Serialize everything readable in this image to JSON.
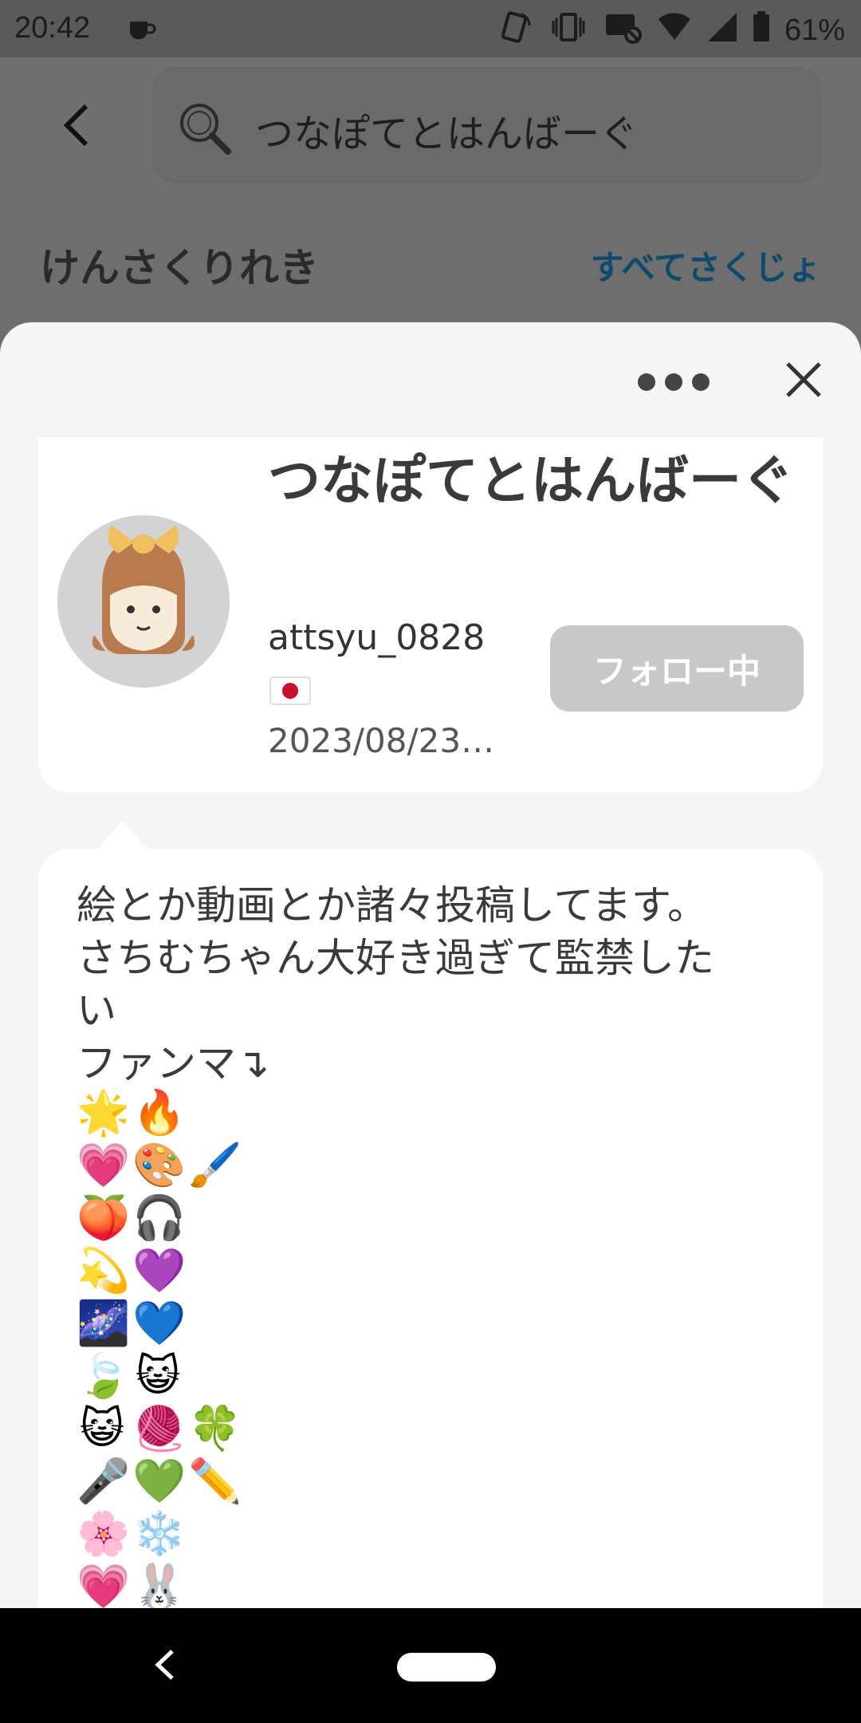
{
  "status_bar": {
    "time": "20:42",
    "battery_text": "61%"
  },
  "search": {
    "query": "つなぽてとはんばーぐ"
  },
  "history": {
    "title": "けんさくりれき",
    "clear_all": "すべてさくじょ"
  },
  "profile": {
    "display_name": "つなぽてとはんばーぐ",
    "username": "attsyu_0828",
    "flag": "🇯🇵",
    "date": "2023/08/23…",
    "follow_label": "フォロー中"
  },
  "bio": {
    "text": "絵とか動画とか諸々投稿してます。\nさちむちゃん大好き過ぎて監禁した\nい\nファンマ↴",
    "emoji_rows": [
      [
        "🌟",
        "🔥"
      ],
      [
        "💗",
        "🎨",
        "🖌️"
      ],
      [
        "🍑",
        "🎧"
      ],
      [
        "💫",
        "💜"
      ],
      [
        "🌌",
        "💙"
      ],
      [
        "🍃",
        "😺"
      ],
      [
        "😺",
        "🧶",
        "🍀"
      ],
      [
        "🎤",
        "💚",
        "✏️"
      ],
      [
        "🌸",
        "❄️"
      ],
      [
        "💗",
        "🐰"
      ]
    ]
  },
  "colors": {
    "accent_link": "#0d4a6b",
    "follow_button_bg": "#c8c8c8"
  }
}
